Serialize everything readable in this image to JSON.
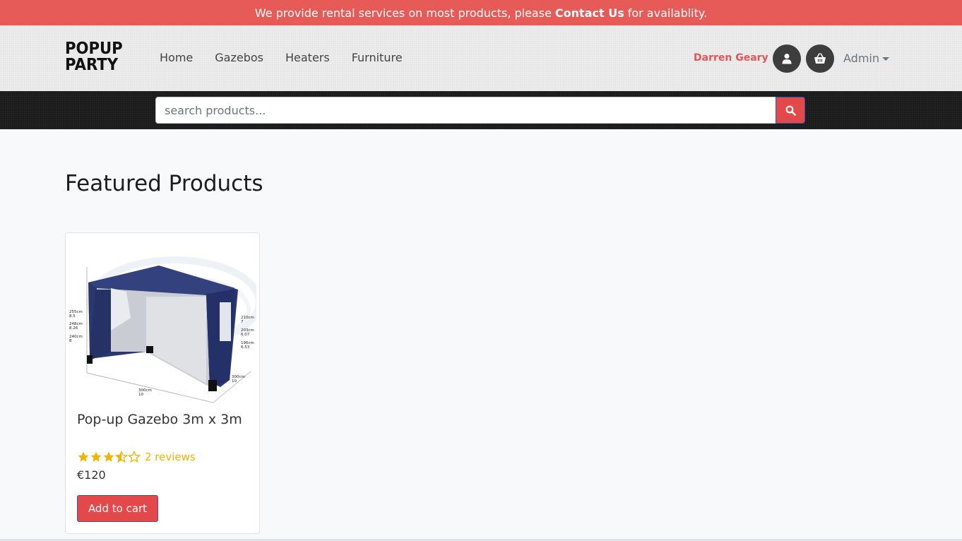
{
  "promo": {
    "text_before": "We provide rental services on most products, please",
    "link": "Contact Us",
    "text_after": "for availablity."
  },
  "brand": {
    "line1": "POPUP",
    "line2": "PARTY"
  },
  "nav": [
    "Home",
    "Gazebos",
    "Heaters",
    "Furniture"
  ],
  "user": {
    "name": "Darren Geary",
    "admin_label": "Admin"
  },
  "search": {
    "placeholder": "search products..."
  },
  "section": {
    "title": "Featured Products"
  },
  "product": {
    "title": "Pop-up Gazebo 3m x 3m",
    "rating": 3.5,
    "rating_max": 5,
    "reviews": "2 reviews",
    "price": "€120",
    "button": "Add to cart",
    "image_labels": {
      "left1a": "255cm",
      "left1b": "8.5",
      "left2a": "248cm",
      "left2b": "8.26",
      "left3a": "240cm",
      "left3b": "8",
      "right1a": "210cm",
      "right1b": "7",
      "right2a": "203cm",
      "right2b": "6.07",
      "right3a": "196cm",
      "right3b": "6.53",
      "right4a": "300cm",
      "right4b": "10",
      "bottom_a": "300cm",
      "bottom_b": "10"
    }
  },
  "colors": {
    "accent": "#e3494b",
    "promo_bg": "#e65a57",
    "star": "#f0b400",
    "tent": "#1f2c5e"
  },
  "icons": {
    "user": "user-icon",
    "cart": "basket-icon",
    "search": "search-icon"
  }
}
